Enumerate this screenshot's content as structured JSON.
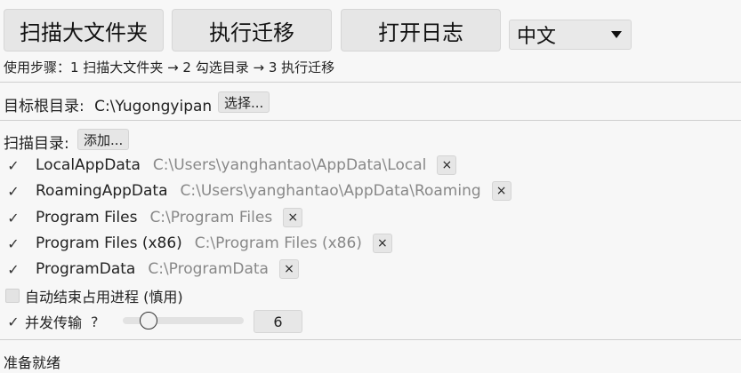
{
  "toolbar": {
    "scan_label": "扫描大文件夹",
    "migrate_label": "执行迁移",
    "log_label": "打开日志",
    "language_selected": "中文"
  },
  "usage_hint": "使用步骤：1 扫描大文件夹 → 2 勾选目录 → 3 执行迁移",
  "target": {
    "label": "目标根目录:",
    "path": "C:\\Yugongyipan",
    "choose_label": "选择..."
  },
  "scan_dirs": {
    "label": "扫描目录:",
    "add_label": "添加...",
    "remove_glyph": "×",
    "check_glyph": "✓",
    "items": [
      {
        "name": "LocalAppData",
        "path": "C:\\Users\\yanghantao\\AppData\\Local"
      },
      {
        "name": "RoamingAppData",
        "path": "C:\\Users\\yanghantao\\AppData\\Roaming"
      },
      {
        "name": "Program Files",
        "path": "C:\\Program Files"
      },
      {
        "name": "Program Files (x86)",
        "path": "C:\\Program Files (x86)"
      },
      {
        "name": "ProgramData",
        "path": "C:\\ProgramData"
      }
    ]
  },
  "options": {
    "auto_kill_label": "自动结束占用进程 (慎用)",
    "concurrent_label": "并发传输",
    "help_glyph": "?",
    "concurrent_value": "6",
    "slider_min": 1,
    "slider_max": 32,
    "slider_level": 6
  },
  "status": "准备就绪"
}
